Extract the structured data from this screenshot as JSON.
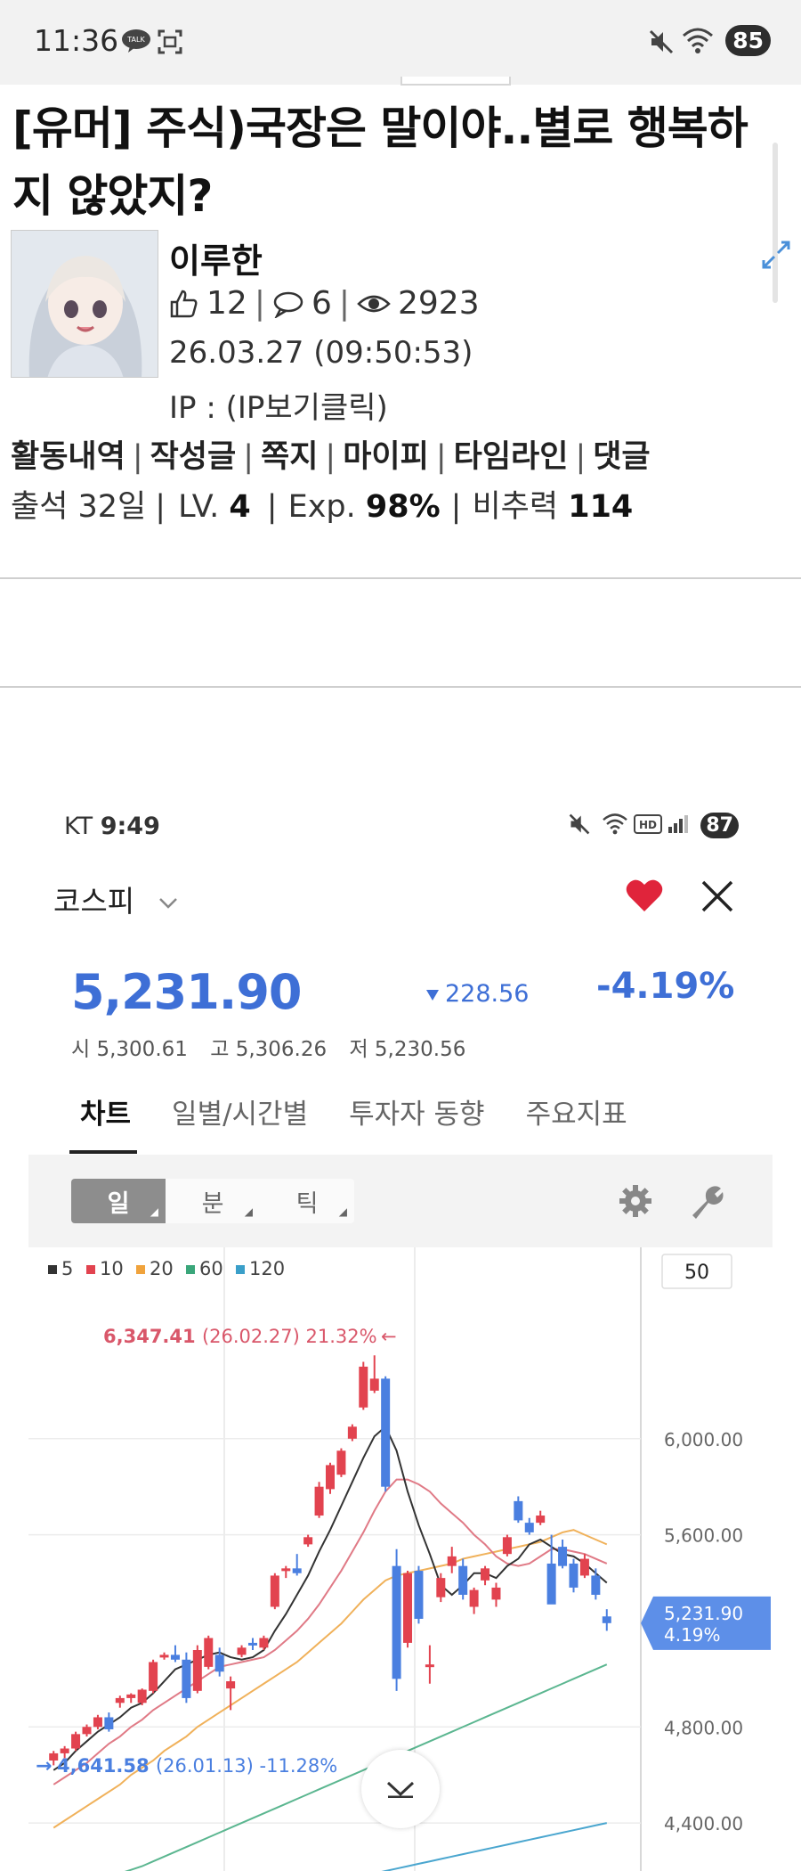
{
  "status_bar": {
    "time": "11:36",
    "battery": "85"
  },
  "post": {
    "title": "[유머] 주식)국장은 말이야..별로 행복하지 않았지?",
    "author": "이루한",
    "likes": "12",
    "comments": "6",
    "views": "2923",
    "date": "26.03.27 (09:50:53)",
    "ip_label": "IP : (IP보기클릭)",
    "links": [
      "활동내역",
      "작성글",
      "쪽지",
      "마이피",
      "타임라인",
      "댓글"
    ],
    "attendance": "출석 32일",
    "level_label": "LV.",
    "level": "4",
    "exp_label": "Exp.",
    "exp": "98%",
    "rec_label": "비추력",
    "rec": "114"
  },
  "embedded": {
    "carrier": "KT",
    "time": "9:49",
    "battery": "87",
    "index_name": "코스피",
    "price": "5,231.90",
    "change": "228.56",
    "change_pct": "-4.19%",
    "open": "시 5,300.61",
    "high": "고 5,306.26",
    "low": "저 5,230.56",
    "tabs": [
      "차트",
      "일별/시간별",
      "투자자 동향",
      "주요지표"
    ],
    "periods": [
      "일",
      "분",
      "틱"
    ]
  },
  "colors": {
    "accent_blue": "#3e6fd6",
    "up_red": "#e2434f",
    "down_blue": "#4a7fe0",
    "heart_red": "#e0243b"
  },
  "chart_data": {
    "type": "candlestick",
    "legend": [
      "5",
      "10",
      "20",
      "60",
      "120"
    ],
    "legend_colors": [
      "#333333",
      "#e2434f",
      "#f0a33c",
      "#3aa67a",
      "#3a9fc9"
    ],
    "period_box": "50",
    "y_ticks": [
      "6,000.00",
      "5,600.00",
      "4,800.00",
      "4,400.00"
    ],
    "y_tick_values": [
      6000,
      5600,
      4800,
      4400
    ],
    "ylim": [
      4200,
      6500
    ],
    "high_annotation": {
      "value": "6,347.41",
      "text": "(26.02.27) 21.32%",
      "arrow": "←"
    },
    "low_annotation": {
      "arrow": "→",
      "value": "4,641.58",
      "text": "(26.01.13) -11.28%"
    },
    "current_label": {
      "price": "5,231.90",
      "pct": "4.19%"
    },
    "candles": [
      {
        "o": 4660,
        "h": 4700,
        "l": 4640,
        "c": 4690
      },
      {
        "o": 4690,
        "h": 4720,
        "l": 4670,
        "c": 4710
      },
      {
        "o": 4710,
        "h": 4780,
        "l": 4700,
        "c": 4770
      },
      {
        "o": 4770,
        "h": 4810,
        "l": 4760,
        "c": 4800
      },
      {
        "o": 4800,
        "h": 4850,
        "l": 4790,
        "c": 4840
      },
      {
        "o": 4840,
        "h": 4860,
        "l": 4780,
        "c": 4790
      },
      {
        "o": 4900,
        "h": 4930,
        "l": 4880,
        "c": 4920
      },
      {
        "o": 4920,
        "h": 4940,
        "l": 4900,
        "c": 4935
      },
      {
        "o": 4900,
        "h": 4960,
        "l": 4890,
        "c": 4955
      },
      {
        "o": 4950,
        "h": 5080,
        "l": 4940,
        "c": 5070
      },
      {
        "o": 5090,
        "h": 5110,
        "l": 5080,
        "c": 5100
      },
      {
        "o": 5100,
        "h": 5140,
        "l": 5070,
        "c": 5080
      },
      {
        "o": 5080,
        "h": 5110,
        "l": 4900,
        "c": 4920
      },
      {
        "o": 4950,
        "h": 5140,
        "l": 4940,
        "c": 5120
      },
      {
        "o": 5050,
        "h": 5180,
        "l": 5040,
        "c": 5170
      },
      {
        "o": 5100,
        "h": 5130,
        "l": 5010,
        "c": 5030
      },
      {
        "o": 4960,
        "h": 5010,
        "l": 4870,
        "c": 4990
      },
      {
        "o": 5100,
        "h": 5140,
        "l": 5090,
        "c": 5130
      },
      {
        "o": 5150,
        "h": 5170,
        "l": 5120,
        "c": 5140
      },
      {
        "o": 5130,
        "h": 5180,
        "l": 5120,
        "c": 5170
      },
      {
        "o": 5300,
        "h": 5440,
        "l": 5290,
        "c": 5430
      },
      {
        "o": 5450,
        "h": 5470,
        "l": 5420,
        "c": 5460
      },
      {
        "o": 5460,
        "h": 5520,
        "l": 5430,
        "c": 5440
      },
      {
        "o": 5560,
        "h": 5600,
        "l": 5550,
        "c": 5590
      },
      {
        "o": 5680,
        "h": 5820,
        "l": 5670,
        "c": 5800
      },
      {
        "o": 5790,
        "h": 5900,
        "l": 5770,
        "c": 5890
      },
      {
        "o": 5850,
        "h": 5960,
        "l": 5840,
        "c": 5950
      },
      {
        "o": 6000,
        "h": 6060,
        "l": 5990,
        "c": 6050
      },
      {
        "o": 6130,
        "h": 6320,
        "l": 6120,
        "c": 6300
      },
      {
        "o": 6200,
        "h": 6347,
        "l": 6190,
        "c": 6250
      },
      {
        "o": 6250,
        "h": 6260,
        "l": 5780,
        "c": 5800
      },
      {
        "o": 5470,
        "h": 5540,
        "l": 4950,
        "c": 5000
      },
      {
        "o": 5150,
        "h": 5450,
        "l": 5130,
        "c": 5440
      },
      {
        "o": 5450,
        "h": 5470,
        "l": 5230,
        "c": 5250
      },
      {
        "o": 5060,
        "h": 5140,
        "l": 4980,
        "c": 5060
      },
      {
        "o": 5340,
        "h": 5440,
        "l": 5320,
        "c": 5420
      },
      {
        "o": 5470,
        "h": 5550,
        "l": 5440,
        "c": 5510
      },
      {
        "o": 5470,
        "h": 5500,
        "l": 5330,
        "c": 5350
      },
      {
        "o": 5300,
        "h": 5380,
        "l": 5270,
        "c": 5370
      },
      {
        "o": 5410,
        "h": 5470,
        "l": 5390,
        "c": 5460
      },
      {
        "o": 5330,
        "h": 5400,
        "l": 5300,
        "c": 5380
      },
      {
        "o": 5520,
        "h": 5600,
        "l": 5510,
        "c": 5590
      },
      {
        "o": 5740,
        "h": 5760,
        "l": 5650,
        "c": 5660
      },
      {
        "o": 5650,
        "h": 5670,
        "l": 5600,
        "c": 5610
      },
      {
        "o": 5650,
        "h": 5700,
        "l": 5640,
        "c": 5680
      },
      {
        "o": 5480,
        "h": 5600,
        "l": 5320,
        "c": 5310
      },
      {
        "o": 5550,
        "h": 5580,
        "l": 5460,
        "c": 5470
      },
      {
        "o": 5480,
        "h": 5500,
        "l": 5360,
        "c": 5380
      },
      {
        "o": 5430,
        "h": 5520,
        "l": 5420,
        "c": 5500
      },
      {
        "o": 5430,
        "h": 5460,
        "l": 5330,
        "c": 5350
      },
      {
        "o": 5260,
        "h": 5290,
        "l": 5200,
        "c": 5232
      }
    ],
    "ma5": [
      4620,
      4650,
      4700,
      4740,
      4780,
      4810,
      4840,
      4880,
      4900,
      4940,
      4990,
      5040,
      5060,
      5080,
      5100,
      5110,
      5090,
      5080,
      5090,
      5120,
      5200,
      5270,
      5350,
      5430,
      5530,
      5620,
      5720,
      5820,
      5920,
      6010,
      6050,
      5950,
      5780,
      5640,
      5520,
      5390,
      5350,
      5390,
      5440,
      5440,
      5420,
      5470,
      5500,
      5560,
      5580,
      5550,
      5520,
      5510,
      5480,
      5440,
      5400
    ],
    "ma10": [
      4560,
      4590,
      4620,
      4650,
      4690,
      4730,
      4760,
      4800,
      4830,
      4870,
      4900,
      4930,
      4960,
      4990,
      5020,
      5050,
      5060,
      5070,
      5080,
      5090,
      5120,
      5160,
      5200,
      5250,
      5310,
      5380,
      5450,
      5530,
      5610,
      5700,
      5780,
      5830,
      5830,
      5810,
      5780,
      5730,
      5690,
      5650,
      5600,
      5560,
      5510,
      5480,
      5470,
      5480,
      5510,
      5540,
      5540,
      5530,
      5520,
      5500,
      5480
    ],
    "ma20": [
      4380,
      4410,
      4440,
      4470,
      4500,
      4530,
      4560,
      4600,
      4630,
      4660,
      4700,
      4730,
      4760,
      4800,
      4830,
      4860,
      4890,
      4920,
      4950,
      4980,
      5010,
      5040,
      5070,
      5110,
      5150,
      5190,
      5230,
      5280,
      5330,
      5370,
      5410,
      5430,
      5440,
      5450,
      5460,
      5470,
      5480,
      5500,
      5510,
      5520,
      5530,
      5540,
      5550,
      5560,
      5570,
      5590,
      5610,
      5620,
      5600,
      5580,
      5560
    ],
    "ma60": [
      4100,
      4115,
      4130,
      4145,
      4160,
      4175,
      4190,
      4205,
      4220,
      4240,
      4260,
      4280,
      4300,
      4320,
      4340,
      4360,
      4380,
      4400,
      4420,
      4440,
      4460,
      4480,
      4500,
      4520,
      4540,
      4560,
      4580,
      4600,
      4620,
      4640,
      4660,
      4680,
      4700,
      4720,
      4740,
      4760,
      4780,
      4800,
      4820,
      4840,
      4860,
      4880,
      4900,
      4920,
      4940,
      4960,
      4980,
      5000,
      5020,
      5040,
      5060
    ],
    "ma120": [
      3900,
      3910,
      3920,
      3930,
      3940,
      3950,
      3960,
      3970,
      3980,
      3990,
      4000,
      4010,
      4020,
      4030,
      4040,
      4050,
      4060,
      4070,
      4080,
      4090,
      4100,
      4110,
      4120,
      4130,
      4140,
      4150,
      4160,
      4170,
      4180,
      4190,
      4200,
      4210,
      4220,
      4230,
      4240,
      4250,
      4260,
      4270,
      4280,
      4290,
      4300,
      4310,
      4320,
      4330,
      4340,
      4350,
      4360,
      4370,
      4380,
      4390,
      4400
    ]
  }
}
